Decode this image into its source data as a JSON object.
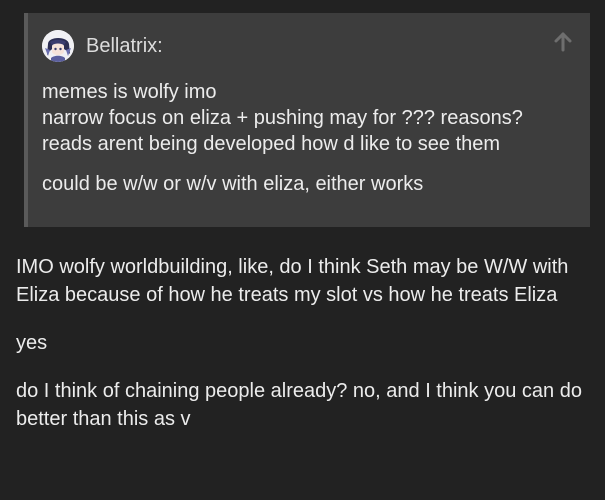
{
  "quote": {
    "author": "Bellatrix:",
    "lines": [
      "memes is wolfy imo",
      "narrow focus on eliza + pushing may for ??? reasons?",
      "reads arent being developed how d like to see them",
      "could be w/w or w/v with eliza, either works"
    ]
  },
  "post": {
    "paragraphs": [
      "IMO wolfy worldbuilding, like, do I think Seth may be W/W with Eliza because of how he treats my slot vs how he treats Eliza",
      "yes",
      "do I think of chaining people already? no, and I think you can do better than this as v"
    ]
  },
  "icons": {
    "jump": "arrow-up-icon"
  },
  "colors": {
    "background": "#222222",
    "quote_background": "#3d3d3d",
    "text": "#ececec"
  }
}
